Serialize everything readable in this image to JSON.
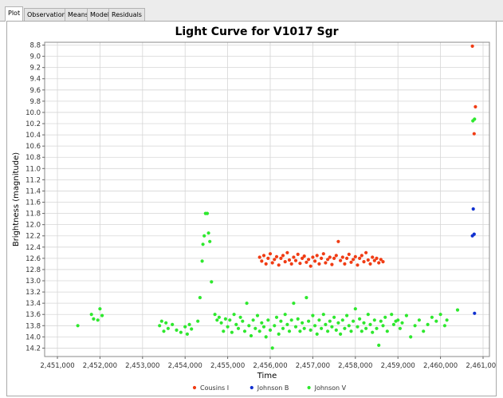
{
  "tabs": [
    {
      "label": "Plot",
      "active": true
    },
    {
      "label": "Observations",
      "active": false
    },
    {
      "label": "Means",
      "active": false
    },
    {
      "label": "Model",
      "active": false
    },
    {
      "label": "Residuals",
      "active": false
    }
  ],
  "chart_data": {
    "type": "scatter",
    "title": "Light Curve for V1017 Sgr",
    "xlabel": "Time",
    "ylabel": "Brightness (magnitude)",
    "xlim": [
      2450700,
      2461150
    ],
    "ylim": [
      14.35,
      8.75
    ],
    "y_inverted": true,
    "xticks": [
      2451000,
      2452000,
      2453000,
      2454000,
      2455000,
      2456000,
      2457000,
      2458000,
      2459000,
      2460000,
      2461000
    ],
    "xtick_labels": [
      "2,451,000",
      "2,452,000",
      "2,453,000",
      "2,454,000",
      "2,455,000",
      "2,456,000",
      "2,457,000",
      "2,458,000",
      "2,459,000",
      "2,460,000",
      "2,461,000"
    ],
    "yticks": [
      8.8,
      9.0,
      9.2,
      9.4,
      9.6,
      9.8,
      10.0,
      10.2,
      10.4,
      10.6,
      10.8,
      11.0,
      11.2,
      11.4,
      11.6,
      11.8,
      12.0,
      12.2,
      12.4,
      12.6,
      12.8,
      13.0,
      13.2,
      13.4,
      13.6,
      13.8,
      14.0,
      14.2
    ],
    "ytick_labels": [
      "8.8",
      "9.0",
      "9.2",
      "9.4",
      "9.6",
      "9.8",
      "10.0",
      "10.2",
      "10.4",
      "10.6",
      "10.8",
      "11.0",
      "11.2",
      "11.4",
      "11.6",
      "11.8",
      "12.0",
      "12.2",
      "12.4",
      "12.6",
      "12.8",
      "13.0",
      "13.2",
      "13.4",
      "13.6",
      "13.8",
      "14.0",
      "14.2"
    ],
    "grid": true,
    "legend_position": "bottom-center",
    "series": [
      {
        "name": "Cousins I",
        "color": "#f03c14",
        "points": [
          [
            2460750,
            8.82
          ],
          [
            2460820,
            9.9
          ],
          [
            2460790,
            10.38
          ],
          [
            2455750,
            12.58
          ],
          [
            2455800,
            12.65
          ],
          [
            2455850,
            12.55
          ],
          [
            2455900,
            12.7
          ],
          [
            2455950,
            12.6
          ],
          [
            2456000,
            12.52
          ],
          [
            2456050,
            12.68
          ],
          [
            2456100,
            12.62
          ],
          [
            2456150,
            12.57
          ],
          [
            2456200,
            12.72
          ],
          [
            2456250,
            12.6
          ],
          [
            2456300,
            12.55
          ],
          [
            2456350,
            12.66
          ],
          [
            2456400,
            12.5
          ],
          [
            2456450,
            12.63
          ],
          [
            2456500,
            12.7
          ],
          [
            2456550,
            12.58
          ],
          [
            2456600,
            12.64
          ],
          [
            2456650,
            12.53
          ],
          [
            2456700,
            12.69
          ],
          [
            2456750,
            12.6
          ],
          [
            2456800,
            12.56
          ],
          [
            2456850,
            12.67
          ],
          [
            2456900,
            12.62
          ],
          [
            2456950,
            12.74
          ],
          [
            2457000,
            12.58
          ],
          [
            2457050,
            12.65
          ],
          [
            2457100,
            12.55
          ],
          [
            2457150,
            12.7
          ],
          [
            2457200,
            12.6
          ],
          [
            2457250,
            12.52
          ],
          [
            2457300,
            12.68
          ],
          [
            2457350,
            12.62
          ],
          [
            2457400,
            12.58
          ],
          [
            2457450,
            12.71
          ],
          [
            2457500,
            12.6
          ],
          [
            2457550,
            12.55
          ],
          [
            2457600,
            12.3
          ],
          [
            2457650,
            12.64
          ],
          [
            2457700,
            12.58
          ],
          [
            2457750,
            12.7
          ],
          [
            2457800,
            12.6
          ],
          [
            2457850,
            12.53
          ],
          [
            2457900,
            12.67
          ],
          [
            2457950,
            12.62
          ],
          [
            2458000,
            12.57
          ],
          [
            2458050,
            12.72
          ],
          [
            2458100,
            12.6
          ],
          [
            2458150,
            12.55
          ],
          [
            2458200,
            12.66
          ],
          [
            2458250,
            12.5
          ],
          [
            2458300,
            12.63
          ],
          [
            2458350,
            12.7
          ],
          [
            2458400,
            12.58
          ],
          [
            2458450,
            12.64
          ],
          [
            2458500,
            12.6
          ],
          [
            2458550,
            12.68
          ],
          [
            2458600,
            12.62
          ],
          [
            2458650,
            12.66
          ]
        ]
      },
      {
        "name": "Johnson B",
        "color": "#1030d0",
        "points": [
          [
            2460770,
            11.72
          ],
          [
            2460790,
            12.17
          ],
          [
            2460750,
            12.2
          ],
          [
            2460800,
            13.58
          ]
        ]
      },
      {
        "name": "Johnson V",
        "color": "#2ee82e",
        "points": [
          [
            2451480,
            13.8
          ],
          [
            2451800,
            13.6
          ],
          [
            2451850,
            13.68
          ],
          [
            2451950,
            13.7
          ],
          [
            2452000,
            13.5
          ],
          [
            2452050,
            13.62
          ],
          [
            2453400,
            13.8
          ],
          [
            2453450,
            13.72
          ],
          [
            2453500,
            13.9
          ],
          [
            2453550,
            13.75
          ],
          [
            2453600,
            13.85
          ],
          [
            2453700,
            13.78
          ],
          [
            2453800,
            13.88
          ],
          [
            2453900,
            13.92
          ],
          [
            2454000,
            13.82
          ],
          [
            2454050,
            13.95
          ],
          [
            2454100,
            13.78
          ],
          [
            2454150,
            13.86
          ],
          [
            2454300,
            13.72
          ],
          [
            2454350,
            13.3
          ],
          [
            2454400,
            12.65
          ],
          [
            2454420,
            12.35
          ],
          [
            2454450,
            12.2
          ],
          [
            2454480,
            11.8
          ],
          [
            2454520,
            11.8
          ],
          [
            2454550,
            12.15
          ],
          [
            2454580,
            12.3
          ],
          [
            2454620,
            13.02
          ],
          [
            2454700,
            13.6
          ],
          [
            2454750,
            13.7
          ],
          [
            2454800,
            13.65
          ],
          [
            2454850,
            13.75
          ],
          [
            2454900,
            13.9
          ],
          [
            2454950,
            13.68
          ],
          [
            2455000,
            13.82
          ],
          [
            2455050,
            13.7
          ],
          [
            2455100,
            13.92
          ],
          [
            2455150,
            13.6
          ],
          [
            2455200,
            13.78
          ],
          [
            2455250,
            13.85
          ],
          [
            2455300,
            13.65
          ],
          [
            2455350,
            13.72
          ],
          [
            2455400,
            13.9
          ],
          [
            2455450,
            13.4
          ],
          [
            2455500,
            13.8
          ],
          [
            2455550,
            13.98
          ],
          [
            2455600,
            13.7
          ],
          [
            2455650,
            13.85
          ],
          [
            2455700,
            13.62
          ],
          [
            2455750,
            13.9
          ],
          [
            2455800,
            13.75
          ],
          [
            2455850,
            13.82
          ],
          [
            2455900,
            14.0
          ],
          [
            2455950,
            13.7
          ],
          [
            2456000,
            13.88
          ],
          [
            2456050,
            14.2
          ],
          [
            2456100,
            13.8
          ],
          [
            2456150,
            13.65
          ],
          [
            2456200,
            13.95
          ],
          [
            2456250,
            13.72
          ],
          [
            2456300,
            13.85
          ],
          [
            2456350,
            13.6
          ],
          [
            2456400,
            13.78
          ],
          [
            2456450,
            13.9
          ],
          [
            2456500,
            13.7
          ],
          [
            2456550,
            13.4
          ],
          [
            2456600,
            13.82
          ],
          [
            2456650,
            13.68
          ],
          [
            2456700,
            13.9
          ],
          [
            2456750,
            13.75
          ],
          [
            2456800,
            13.85
          ],
          [
            2456850,
            13.3
          ],
          [
            2456900,
            13.72
          ],
          [
            2456950,
            13.88
          ],
          [
            2457000,
            13.62
          ],
          [
            2457050,
            13.8
          ],
          [
            2457100,
            13.95
          ],
          [
            2457150,
            13.7
          ],
          [
            2457200,
            13.85
          ],
          [
            2457250,
            13.6
          ],
          [
            2457300,
            13.78
          ],
          [
            2457350,
            13.9
          ],
          [
            2457400,
            13.72
          ],
          [
            2457450,
            13.82
          ],
          [
            2457500,
            13.65
          ],
          [
            2457550,
            13.88
          ],
          [
            2457600,
            13.75
          ],
          [
            2457650,
            13.95
          ],
          [
            2457700,
            13.7
          ],
          [
            2457750,
            13.85
          ],
          [
            2457800,
            13.62
          ],
          [
            2457850,
            13.8
          ],
          [
            2457900,
            13.9
          ],
          [
            2457950,
            13.72
          ],
          [
            2458000,
            13.5
          ],
          [
            2458050,
            13.82
          ],
          [
            2458100,
            13.68
          ],
          [
            2458150,
            13.9
          ],
          [
            2458200,
            13.75
          ],
          [
            2458250,
            13.85
          ],
          [
            2458300,
            13.6
          ],
          [
            2458350,
            13.78
          ],
          [
            2458400,
            13.92
          ],
          [
            2458450,
            13.7
          ],
          [
            2458500,
            13.85
          ],
          [
            2458550,
            14.15
          ],
          [
            2458600,
            13.72
          ],
          [
            2458650,
            13.8
          ],
          [
            2458700,
            13.65
          ],
          [
            2458750,
            13.9
          ],
          [
            2458850,
            13.6
          ],
          [
            2458900,
            13.78
          ],
          [
            2458950,
            13.72
          ],
          [
            2459000,
            13.7
          ],
          [
            2459050,
            13.85
          ],
          [
            2459100,
            13.75
          ],
          [
            2459200,
            13.62
          ],
          [
            2459300,
            14.0
          ],
          [
            2459400,
            13.8
          ],
          [
            2459500,
            13.7
          ],
          [
            2459600,
            13.9
          ],
          [
            2459700,
            13.78
          ],
          [
            2459800,
            13.65
          ],
          [
            2459900,
            13.72
          ],
          [
            2460000,
            13.6
          ],
          [
            2460100,
            13.8
          ],
          [
            2460150,
            13.7
          ],
          [
            2460400,
            13.52
          ],
          [
            2460760,
            10.15
          ],
          [
            2460800,
            10.12
          ]
        ]
      }
    ]
  }
}
